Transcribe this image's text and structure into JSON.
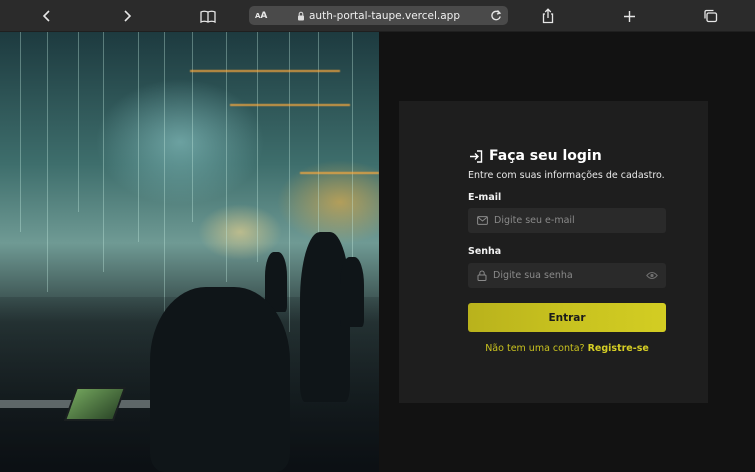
{
  "browser": {
    "aa_label_small": "A",
    "aa_label_big": "A",
    "url": "auth-portal-taupe.vercel.app"
  },
  "login": {
    "title": "Faça seu login",
    "subtitle": "Entre com suas informações de cadastro.",
    "email_label": "E-mail",
    "email_placeholder": "Digite seu e-mail",
    "password_label": "Senha",
    "password_placeholder": "Digite sua senha",
    "submit_label": "Entrar",
    "register_prompt": "Não tem uma conta?",
    "register_link": "Registre-se"
  },
  "colors": {
    "accent": "#c8c21f",
    "card_bg": "#1e1e1e",
    "page_bg": "#121212"
  }
}
